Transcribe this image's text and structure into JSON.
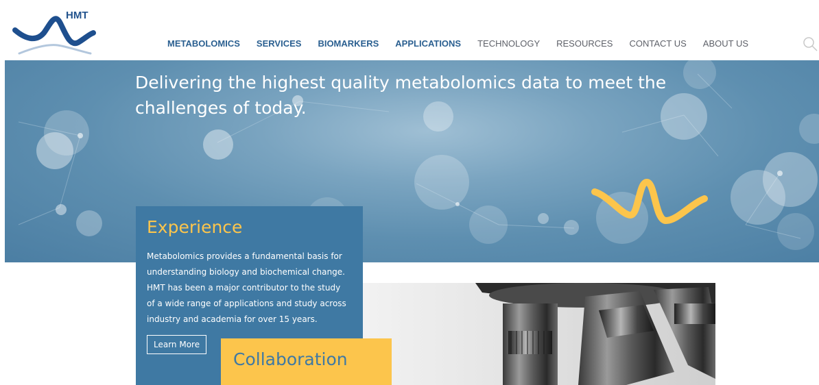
{
  "header": {
    "logo_text": "HMT",
    "nav": [
      {
        "label": "METABOLOMICS",
        "weight": "bold"
      },
      {
        "label": "SERVICES",
        "weight": "bold"
      },
      {
        "label": "BIOMARKERS",
        "weight": "bold"
      },
      {
        "label": "APPLICATIONS",
        "weight": "bold"
      },
      {
        "label": "TECHNOLOGY",
        "weight": "light"
      },
      {
        "label": "RESOURCES",
        "weight": "light"
      },
      {
        "label": "CONTACT US",
        "weight": "light"
      },
      {
        "label": "ABOUT US",
        "weight": "light"
      }
    ],
    "search_icon": "search-icon"
  },
  "hero": {
    "headline_line1": "Delivering the highest quality metabolomics data to meet the",
    "headline_line2": "challenges of today."
  },
  "experience": {
    "title": "Experience",
    "body_lines": [
      "Metabolomics provides a fundamental basis for",
      "understanding biology and biochemical change.",
      "HMT has been a major contributor to the study",
      "of a wide range of applications and study across",
      "industry and academia for over 15 years."
    ],
    "button_label": "Learn More"
  },
  "collaboration": {
    "title": "Collaboration"
  },
  "colors": {
    "brand_blue": "#3f79a3",
    "brand_yellow": "#fcc54c",
    "nav_bold": "#2a5f90",
    "nav_light": "#5e6169"
  }
}
